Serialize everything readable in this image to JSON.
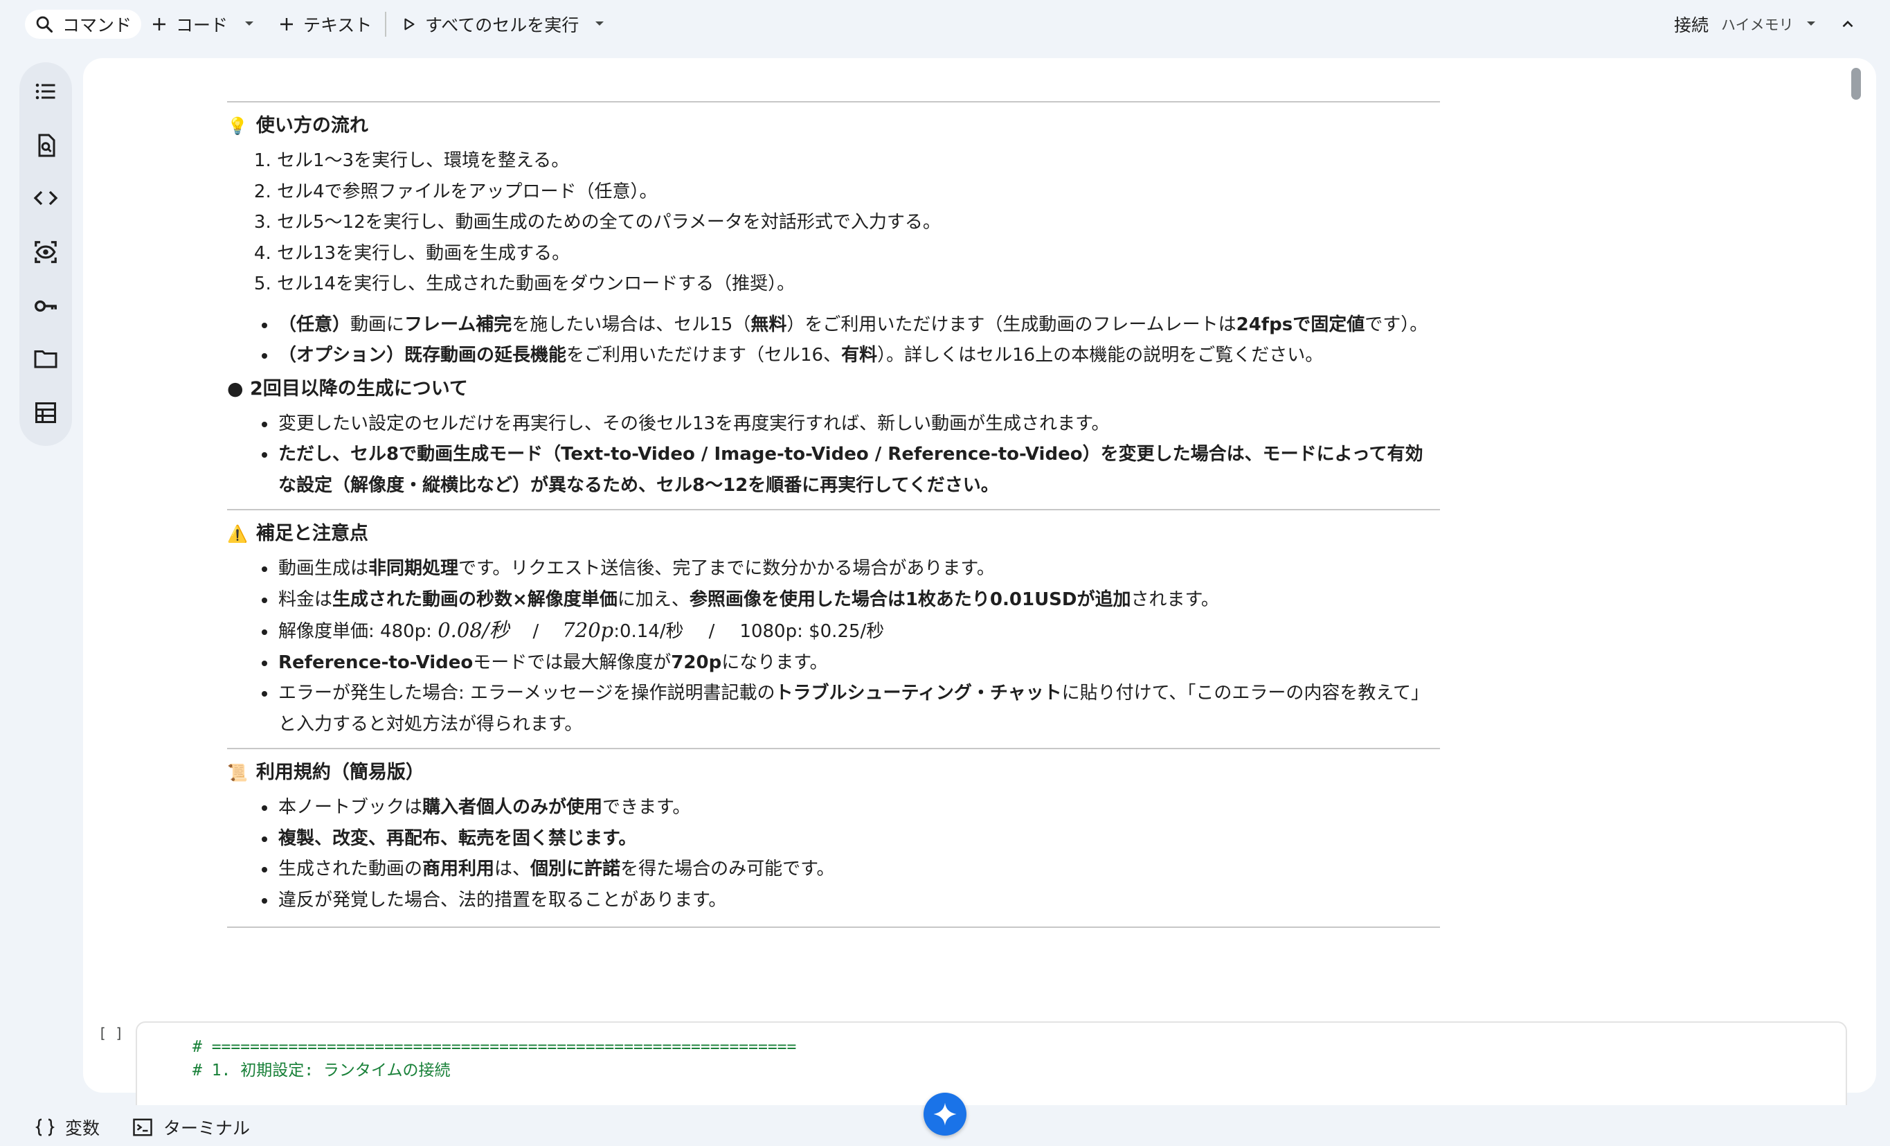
{
  "toolbar": {
    "command_label": "コマンド",
    "code_label": "コード",
    "text_label": "テキスト",
    "run_all_label": "すべてのセルを実行",
    "connect_label": "接続",
    "ram_label": "ハイメモリ"
  },
  "rail": {
    "items": [
      "table-of-contents-icon",
      "find-icon",
      "code-snippets-icon",
      "variables-inspector-icon",
      "secrets-key-icon",
      "files-folder-icon",
      "data-table-icon"
    ]
  },
  "notebook": {
    "usage": {
      "title": "使い方の流れ",
      "steps": [
        "セル1〜3を実行し、環境を整える。",
        "セル4で参照ファイルをアップロード（任意）。",
        "セル5〜12を実行し、動画生成のための全てのパラメータを対話形式で入力する。",
        "セル13を実行し、動画を生成する。",
        "セル14を実行し、生成された動画をダウンロードする（推奨）。"
      ],
      "bullet1": {
        "a": "（任意）",
        "b": "動画に",
        "c": "フレーム補完",
        "d": "を施したい場合は、セル15（",
        "e": "無料",
        "f": "）をご利用いただけます（生成動画のフレームレートは",
        "g": "24fpsで固定値",
        "h": "です）。"
      },
      "bullet2": {
        "a": "（オプション）既存動画の延長機能",
        "b": "をご利用いただけます（セル16、",
        "c": "有料",
        "d": "）。詳しくはセル16上の本機能の説明をご覧ください。"
      }
    },
    "regen": {
      "title": "● 2回目以降の生成について",
      "item1": "変更したい設定のセルだけを再実行し、その後セル13を再度実行すれば、新しい動画が生成されます。",
      "item2": "ただし、セル8で動画生成モード（Text-to-Video / Image-to-Video / Reference-to-Video）を変更した場合は、モードによって有効な設定（解像度・縦横比など）が異なるため、セル8〜12を順番に再実行してください。"
    },
    "notes": {
      "title": "補足と注意点",
      "n1": {
        "a": "動画生成は",
        "b": "非同期処理",
        "c": "です。リクエスト送信後、完了までに数分かかる場合があります。"
      },
      "n2": {
        "a": "料金は",
        "b": "生成された動画の秒数×解像度単価",
        "c": "に加え、",
        "d": "参照画像を使用した場合は1枚あたり0.01USDが追加",
        "e": "されます。"
      },
      "n3": {
        "a": "解像度単価: 480p: ",
        "b": "0.08/秒",
        "c": "/",
        "d": "720p",
        "e": ":0.14/秒",
        "f": "/",
        "g": "1080p: $0.25/秒"
      },
      "n4": {
        "a": "Reference-to-Video",
        "b": "モードでは最大解像度が",
        "c": "720p",
        "d": "になります。"
      },
      "n5": {
        "a": "エラーが発生した場合: エラーメッセージを操作説明書記載の",
        "b": "トラブルシューティング・チャット",
        "c": "に貼り付けて、「このエラーの内容を教えて」と入力すると対処方法が得られます。"
      }
    },
    "terms": {
      "title": "利用規約（簡易版）",
      "t1": {
        "a": "本ノートブックは",
        "b": "購入者個人のみが使用",
        "c": "できます。"
      },
      "t2": "複製、改変、再配布、転売を固く禁じます。",
      "t3": {
        "a": "生成された動画の",
        "b": "商用利用",
        "c": "は、",
        "d": "個別に許諾",
        "e": "を得た場合のみ可能です。"
      },
      "t4": "違反が発覚した場合、法的措置を取ることがあります。"
    },
    "code_cell": {
      "bracket": "[ ]",
      "line1": "# =============================================================",
      "line2": "# 1. 初期設定: ランタイムの接続"
    }
  },
  "bottombar": {
    "variables_label": "変数",
    "terminal_label": "ターミナル"
  },
  "colors": {
    "accent": "#1a73e8",
    "comment": "#188038",
    "background": "#f0f4f9"
  }
}
